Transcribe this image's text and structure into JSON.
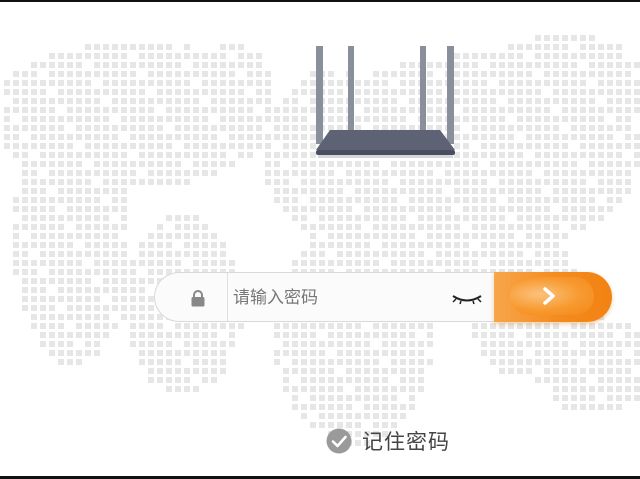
{
  "login": {
    "password_placeholder": "请输入密码",
    "password_value": ""
  },
  "remember": {
    "label": "记住密码",
    "checked": true
  },
  "icons": {
    "lock": "lock-icon",
    "eye": "eye-closed-icon",
    "submit": "chevron-right-icon",
    "remember": "check-circle-icon",
    "illustration": "router-icon"
  },
  "colors": {
    "accent": "#f58a1f",
    "map_dots": "#e6e6e6",
    "router_body": "#5d6375",
    "text": "#444444"
  }
}
